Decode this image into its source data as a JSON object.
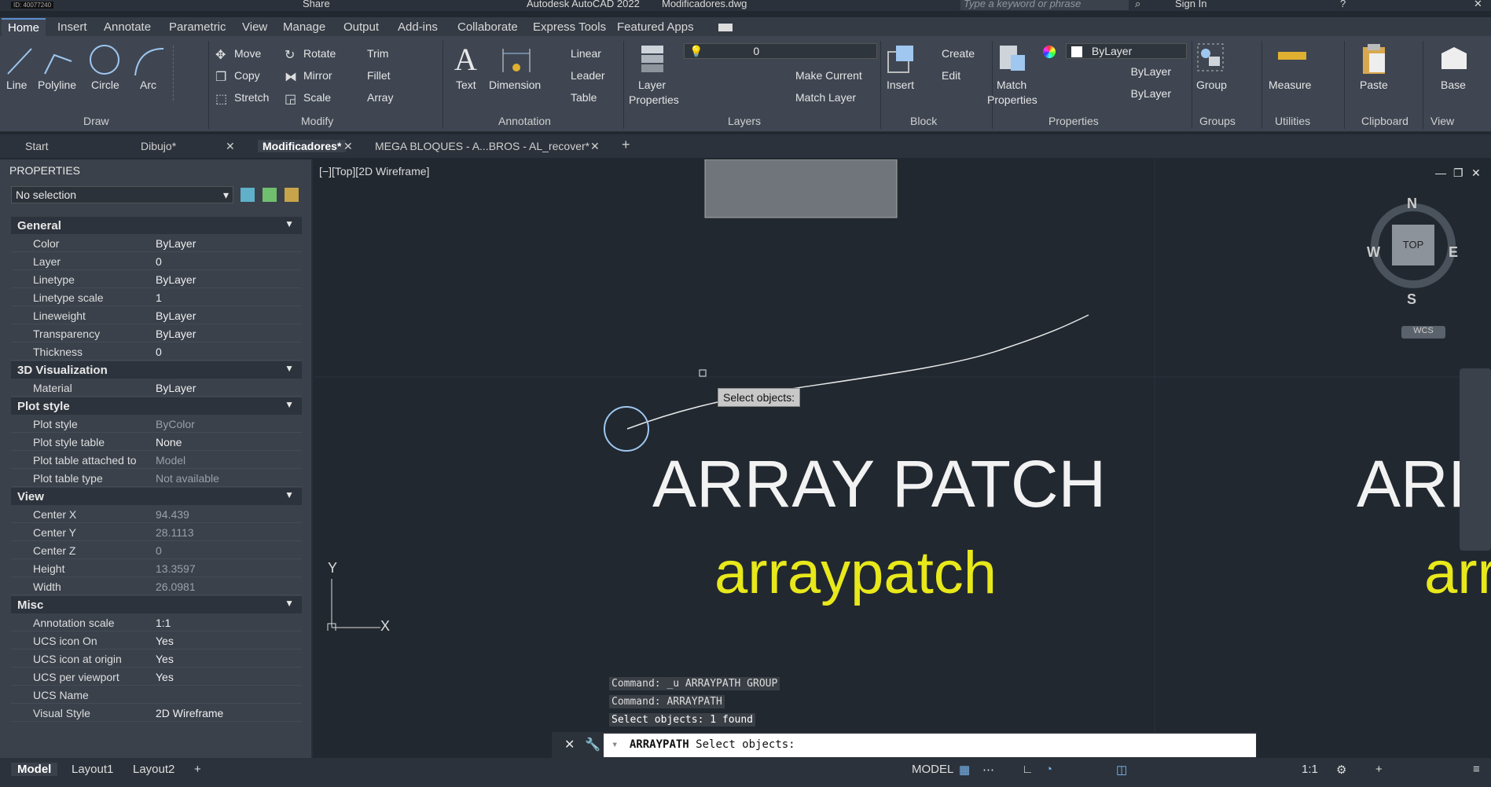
{
  "title": {
    "app": "Autodesk AutoCAD 2022",
    "file": "Modificadores.dwg",
    "share": "Share",
    "search_placeholder": "Type a keyword or phrase",
    "sign_in": "Sign In",
    "id_badge": "ID: 40077240"
  },
  "ribbon_tabs": [
    "Home",
    "Insert",
    "Annotate",
    "Parametric",
    "View",
    "Manage",
    "Output",
    "Add-ins",
    "Collaborate",
    "Express Tools",
    "Featured Apps"
  ],
  "ribbon": {
    "draw": {
      "line": "Line",
      "polyline": "Polyline",
      "circle": "Circle",
      "arc": "Arc",
      "group": "Draw"
    },
    "modify": {
      "move": "Move",
      "rotate": "Rotate",
      "trim": "Trim",
      "copy": "Copy",
      "mirror": "Mirror",
      "fillet": "Fillet",
      "stretch": "Stretch",
      "scale": "Scale",
      "array": "Array",
      "group": "Modify"
    },
    "annotation": {
      "text": "Text",
      "dimension": "Dimension",
      "linear": "Linear",
      "leader": "Leader",
      "table": "Table",
      "group": "Annotation"
    },
    "layers": {
      "layer_properties_1": "Layer",
      "layer_properties_2": "Properties",
      "layer_value": "0",
      "make_current": "Make Current",
      "match_layer": "Match Layer",
      "group": "Layers"
    },
    "block": {
      "insert": "Insert",
      "create": "Create",
      "edit": "Edit",
      "group": "Block"
    },
    "properties": {
      "match_1": "Match",
      "match_2": "Properties",
      "color": "ByLayer",
      "linetype": "ByLayer",
      "lineweight": "ByLayer",
      "group": "Properties"
    },
    "groups": {
      "group": "Group",
      "group_label": "Groups"
    },
    "utilities": {
      "measure": "Measure",
      "group": "Utilities"
    },
    "clipboard": {
      "paste": "Paste",
      "group": "Clipboard"
    },
    "view": {
      "base": "Base",
      "group": "View"
    }
  },
  "doc_tabs": [
    "Start",
    "Dibujo*",
    "Modificadores*",
    "MEGA BLOQUES - A...BROS - AL_recover*"
  ],
  "properties": {
    "header": "PROPERTIES",
    "selection": "No selection",
    "sections": [
      {
        "name": "General",
        "rows": [
          [
            "Color",
            "ByLayer"
          ],
          [
            "Layer",
            "0"
          ],
          [
            "Linetype",
            "ByLayer"
          ],
          [
            "Linetype scale",
            "1"
          ],
          [
            "Lineweight",
            "ByLayer"
          ],
          [
            "Transparency",
            "ByLayer"
          ],
          [
            "Thickness",
            "0"
          ]
        ]
      },
      {
        "name": "3D Visualization",
        "rows": [
          [
            "Material",
            "ByLayer"
          ]
        ]
      },
      {
        "name": "Plot style",
        "rows": [
          [
            "Plot style",
            "ByColor"
          ],
          [
            "Plot style table",
            "None"
          ],
          [
            "Plot table attached to",
            "Model"
          ],
          [
            "Plot table type",
            "Not available"
          ]
        ]
      },
      {
        "name": "View",
        "rows": [
          [
            "Center X",
            "94.439"
          ],
          [
            "Center Y",
            "28.1113"
          ],
          [
            "Center Z",
            "0"
          ],
          [
            "Height",
            "13.3597"
          ],
          [
            "Width",
            "26.0981"
          ]
        ]
      },
      {
        "name": "Misc",
        "rows": [
          [
            "Annotation scale",
            "1:1"
          ],
          [
            "UCS icon On",
            "Yes"
          ],
          [
            "UCS icon at origin",
            "Yes"
          ],
          [
            "UCS per viewport",
            "Yes"
          ],
          [
            "UCS Name",
            ""
          ],
          [
            "Visual Style",
            "2D Wireframe"
          ]
        ]
      }
    ]
  },
  "viewport": {
    "label": "[−][Top][2D Wireframe]",
    "tooltip": "Select objects:",
    "big_text": "ARRAY PATCH",
    "yellow_text": "arraypatch",
    "big_text_right": "ARR",
    "yellow_text_right": "arr",
    "compass": {
      "n": "N",
      "s": "S",
      "e": "E",
      "w": "W",
      "top": "TOP",
      "wcs": "WCS"
    },
    "ucs": {
      "x": "X",
      "y": "Y"
    }
  },
  "command": {
    "history": [
      "Command: _u ARRAYPATH GROUP",
      "Command: ARRAYPATH",
      "Select objects: 1 found"
    ],
    "prompt_cmd": "ARRAYPATH",
    "prompt_text": "Select objects:"
  },
  "layout_tabs": [
    "Model",
    "Layout1",
    "Layout2"
  ],
  "status": {
    "model": "MODEL",
    "scale": "1:1"
  },
  "colors": {
    "yellow": "#e8e81a",
    "accent": "#5a8fd0"
  }
}
